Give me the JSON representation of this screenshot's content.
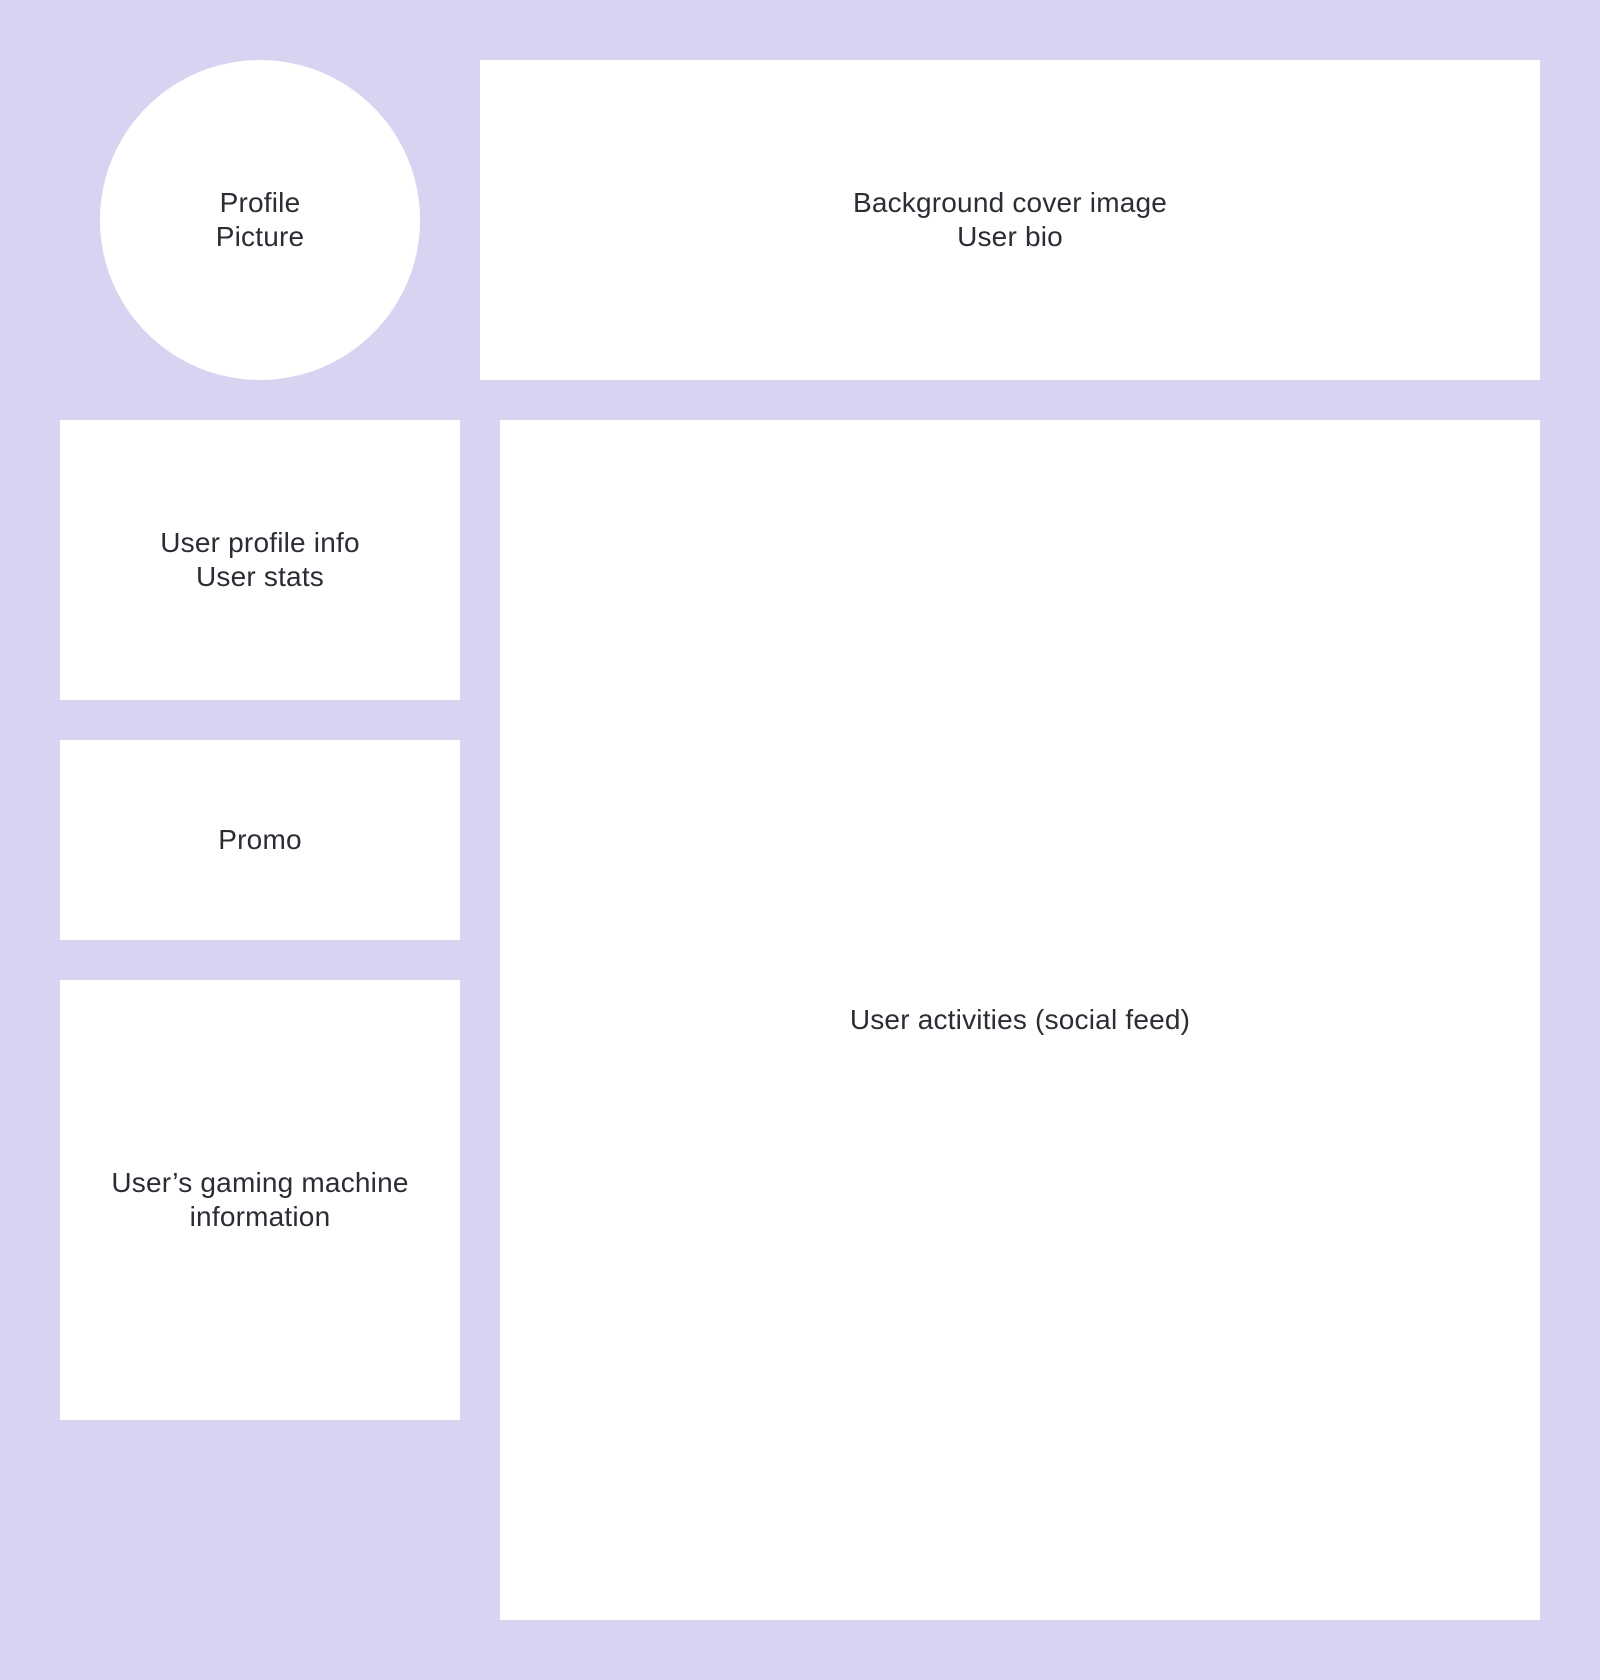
{
  "colors": {
    "background": "#d8d3f1",
    "block_fill": "#ffffff",
    "text": "#2d2b33"
  },
  "header": {
    "profile_picture": {
      "lines": [
        "Profile",
        "Picture"
      ]
    },
    "cover": {
      "lines": [
        "Background cover image",
        "User bio"
      ]
    }
  },
  "sidebar": {
    "profile_info": {
      "lines": [
        "User profile info",
        "User stats"
      ]
    },
    "promo": {
      "lines": [
        "Promo"
      ]
    },
    "gaming_machine": {
      "lines": [
        "User’s gaming machine",
        "information"
      ]
    }
  },
  "main": {
    "feed": {
      "lines": [
        "User activities (social feed)"
      ]
    }
  }
}
